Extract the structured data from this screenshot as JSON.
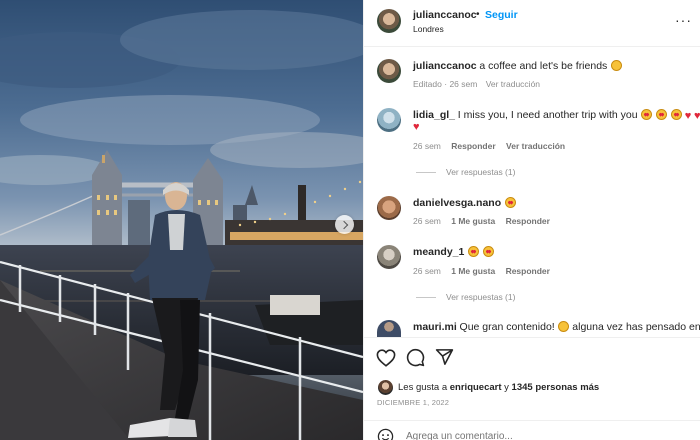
{
  "post": {
    "author": "julianccanoc",
    "follow_label": "Seguir",
    "separator": "•",
    "location": "Londres",
    "caption": "a coffee and let's be friends",
    "caption_meta": {
      "edited": "Editado",
      "dot": "·",
      "age": "26 sem",
      "translate": "Ver traducción"
    }
  },
  "comments": [
    {
      "user": "lidia_gl_",
      "text": "I miss you, I need another trip with you",
      "age": "26 sem",
      "reply": "Responder",
      "translate": "Ver traducción",
      "replies": "Ver respuestas (1)"
    },
    {
      "user": "danielvesga.nano",
      "text": "",
      "age": "26 sem",
      "likes": "1 Me gusta",
      "reply": "Responder"
    },
    {
      "user": "meandy_1",
      "text": "",
      "age": "26 sem",
      "likes": "1 Me gusta",
      "reply": "Responder",
      "replies": "Ver respuestas (1)"
    },
    {
      "user": "mauri.mi",
      "text": "Que gran contenido!",
      "text2": "alguna vez has pensado en"
    }
  ],
  "likes": {
    "prefix": "Les gusta a",
    "user": "enriquecart",
    "conj": "y",
    "others": "1345 personas más"
  },
  "date": "DICIEMBRE 1, 2022",
  "comment_input": {
    "placeholder": "Agrega un comentario..."
  },
  "icons": {
    "like": "heart-outline-icon",
    "comment": "comment-bubble-icon",
    "share": "paper-plane-icon",
    "more": "more-dots-icon",
    "next": "chevron-right-icon",
    "emoji": "smiley-icon"
  },
  "colors": {
    "link": "#0095f6",
    "heart": "#e0283b",
    "text": "#262626",
    "muted": "#8e8e8e"
  }
}
